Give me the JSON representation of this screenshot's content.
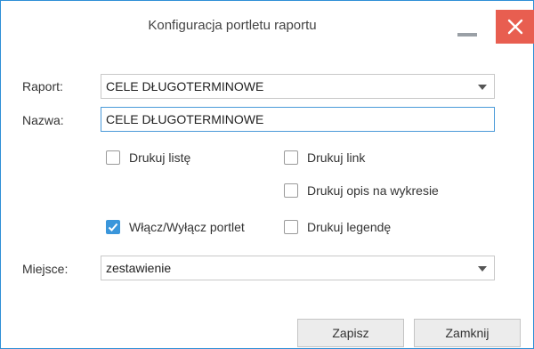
{
  "window": {
    "title": "Konfiguracja portletu raportu"
  },
  "form": {
    "raport_label": "Raport:",
    "raport_value": "CELE DŁUGOTERMINOWE",
    "nazwa_label": "Nazwa:",
    "nazwa_value": "CELE DŁUGOTERMINOWE",
    "checkboxes": {
      "drukuj_liste": {
        "label": "Drukuj listę",
        "checked": false
      },
      "drukuj_link": {
        "label": "Drukuj link",
        "checked": false
      },
      "drukuj_opis": {
        "label": "Drukuj opis na wykresie",
        "checked": false
      },
      "wlacz_portlet": {
        "label": "Włącz/Wyłącz portlet",
        "checked": true
      },
      "drukuj_legende": {
        "label": "Drukuj legendę",
        "checked": false
      }
    },
    "miejsce_label": "Miejsce:",
    "miejsce_value": "zestawienie"
  },
  "buttons": {
    "save": "Zapisz",
    "close": "Zamknij"
  },
  "colors": {
    "accent": "#3a96db",
    "close": "#e85e50"
  }
}
